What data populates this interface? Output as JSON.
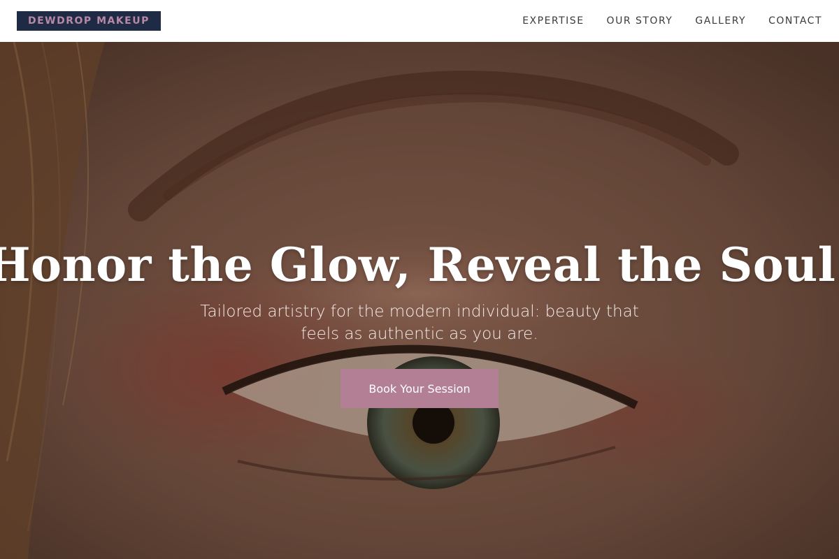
{
  "header": {
    "logo": "DEWDROP MAKEUP",
    "nav": [
      {
        "label": "EXPERTISE"
      },
      {
        "label": "OUR STORY"
      },
      {
        "label": "GALLERY"
      },
      {
        "label": "CONTACT"
      }
    ]
  },
  "hero": {
    "headline": "Honor the Glow, Reveal the Soul.",
    "subheadline": "Tailored artistry for the modern individual: beauty that feels as authentic as you are.",
    "cta_label": "Book Your Session",
    "image": "eye-closeup-photo"
  },
  "colors": {
    "logo_bg": "#1f2a44",
    "logo_text": "#b889a7",
    "cta_bg": "#b37f95",
    "nav_text": "#3a3a3a"
  }
}
